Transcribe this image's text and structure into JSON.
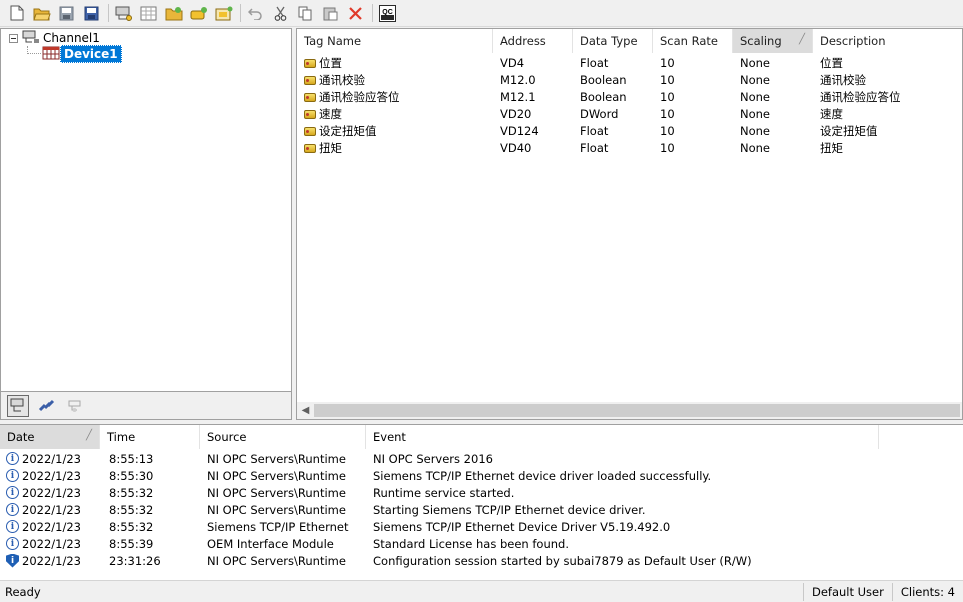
{
  "toolbar": {
    "buttons": [
      "new-icon",
      "open-icon",
      "save-icon",
      "save-as-icon",
      "new-channel-icon",
      "new-device-icon",
      "new-tag-group-icon",
      "new-tag-icon",
      "bulk-tag-icon",
      "undo-icon",
      "cut-icon",
      "copy-icon",
      "paste-icon",
      "delete-icon",
      "quick-client-icon"
    ],
    "quick_client_label": "QC"
  },
  "tree": {
    "channel": "Channel1",
    "device": "Device1"
  },
  "tags": {
    "columns": [
      "Tag Name",
      "Address",
      "Data Type",
      "Scan Rate",
      "Scaling",
      "Description"
    ],
    "rows": [
      {
        "name": "位置",
        "address": "VD4",
        "type": "Float",
        "rate": "10",
        "scaling": "None",
        "desc": "位置"
      },
      {
        "name": "通讯校验",
        "address": "M12.0",
        "type": "Boolean",
        "rate": "10",
        "scaling": "None",
        "desc": "通讯校验"
      },
      {
        "name": "通讯检验应答位",
        "address": "M12.1",
        "type": "Boolean",
        "rate": "10",
        "scaling": "None",
        "desc": "通讯检验应答位"
      },
      {
        "name": "速度",
        "address": "VD20",
        "type": "DWord",
        "rate": "10",
        "scaling": "None",
        "desc": "速度"
      },
      {
        "name": "设定扭矩值",
        "address": "VD124",
        "type": "Float",
        "rate": "10",
        "scaling": "None",
        "desc": "设定扭矩值"
      },
      {
        "name": "扭矩",
        "address": "VD40",
        "type": "Float",
        "rate": "10",
        "scaling": "None",
        "desc": "扭矩"
      }
    ]
  },
  "log": {
    "columns": [
      "Date",
      "Time",
      "Source",
      "Event"
    ],
    "rows": [
      {
        "icon": "info",
        "date": "2022/1/23",
        "time": "8:55:13",
        "source": "NI OPC Servers\\Runtime",
        "event": "NI OPC Servers 2016"
      },
      {
        "icon": "info",
        "date": "2022/1/23",
        "time": "8:55:30",
        "source": "NI OPC Servers\\Runtime",
        "event": "Siemens TCP/IP Ethernet device driver loaded successfully."
      },
      {
        "icon": "info",
        "date": "2022/1/23",
        "time": "8:55:32",
        "source": "NI OPC Servers\\Runtime",
        "event": "Runtime service started."
      },
      {
        "icon": "info",
        "date": "2022/1/23",
        "time": "8:55:32",
        "source": "NI OPC Servers\\Runtime",
        "event": "Starting Siemens TCP/IP Ethernet device driver."
      },
      {
        "icon": "info",
        "date": "2022/1/23",
        "time": "8:55:32",
        "source": "Siemens TCP/IP Ethernet",
        "event": "Siemens TCP/IP Ethernet Device Driver V5.19.492.0"
      },
      {
        "icon": "info",
        "date": "2022/1/23",
        "time": "8:55:39",
        "source": "OEM Interface Module",
        "event": "Standard License has been found."
      },
      {
        "icon": "security",
        "date": "2022/1/23",
        "time": "23:31:26",
        "source": "NI OPC Servers\\Runtime",
        "event": "Configuration session started by subai7879 as Default User (R/W)"
      }
    ]
  },
  "status": {
    "text": "Ready",
    "user": "Default User",
    "clients": "Clients:  4"
  }
}
